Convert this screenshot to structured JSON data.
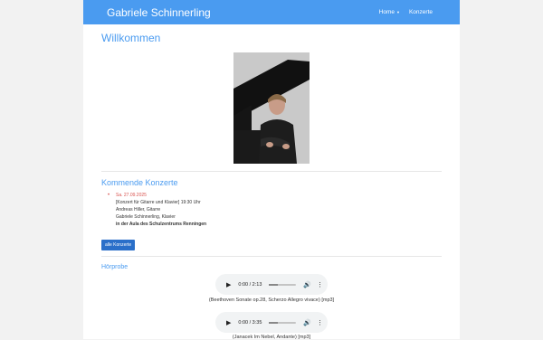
{
  "navbar": {
    "brand": "Gabriele Schinnerling",
    "items": [
      {
        "label": "Home",
        "has_dropdown": true
      },
      {
        "label": "Konzerte",
        "has_dropdown": false
      }
    ],
    "color": "#4a9bf0"
  },
  "main": {
    "title": "Willkommen",
    "upcoming": {
      "heading": "Kommende Konzerte",
      "concert": {
        "date": "Sa. 27.09.2025",
        "line1": "[Konzert für Gitarre und Klavier] 19:30 Uhr",
        "line2": "Andreas Hiller, Gitarre",
        "line3": "Gabriele Schinnerling, Klavier",
        "venue": "in der Aula des Schulzentrums Renningen"
      },
      "all_button": "alle Konzerte"
    },
    "listening": {
      "heading": "Hörprobe",
      "tracks": [
        {
          "time": "0:00 / 2:13",
          "caption": "(Beethoven Sonate op.28, Scherzo Allegro vivace) [mp3]"
        },
        {
          "time": "0:00 / 3:35",
          "caption": "(Janacek Im Nebel, Andante) [mp3]"
        }
      ]
    }
  }
}
